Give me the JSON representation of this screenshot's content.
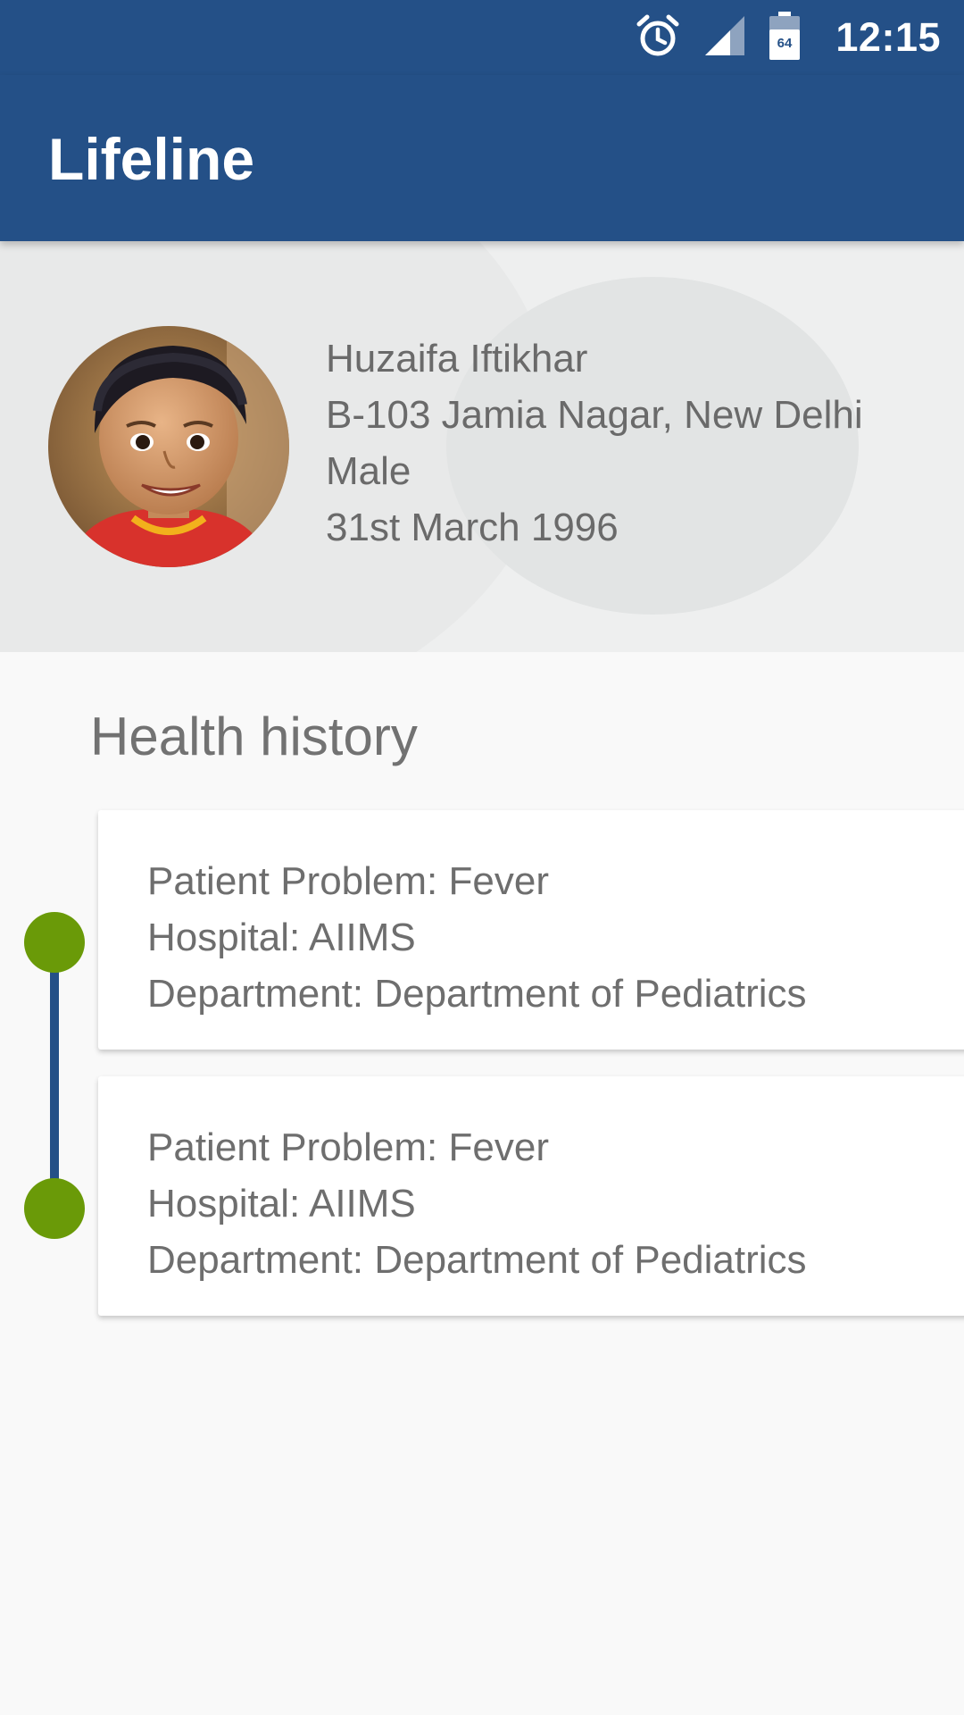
{
  "status_bar": {
    "time": "12:15",
    "battery_level": "64",
    "icons": [
      "alarm-clock-icon",
      "signal-icon",
      "battery-icon"
    ]
  },
  "app_bar": {
    "title": "Lifeline"
  },
  "profile": {
    "name": "Huzaifa Iftikhar",
    "address": "B-103 Jamia Nagar, New Delhi",
    "gender": "Male",
    "dob": "31st March 1996"
  },
  "health_history": {
    "title": "Health history",
    "records": [
      {
        "problem": "Patient Problem: Fever",
        "hospital": "Hospital: AIIMS",
        "department": "Department: Department of Pediatrics"
      },
      {
        "problem": "Patient Problem: Fever",
        "hospital": "Hospital: AIIMS",
        "department": "Department: Department of Pediatrics"
      }
    ]
  },
  "colors": {
    "primary": "#245087",
    "timeline_dot": "#6a9a08",
    "header_bg": "#eeefef",
    "page_bg": "#f9f9f9"
  }
}
